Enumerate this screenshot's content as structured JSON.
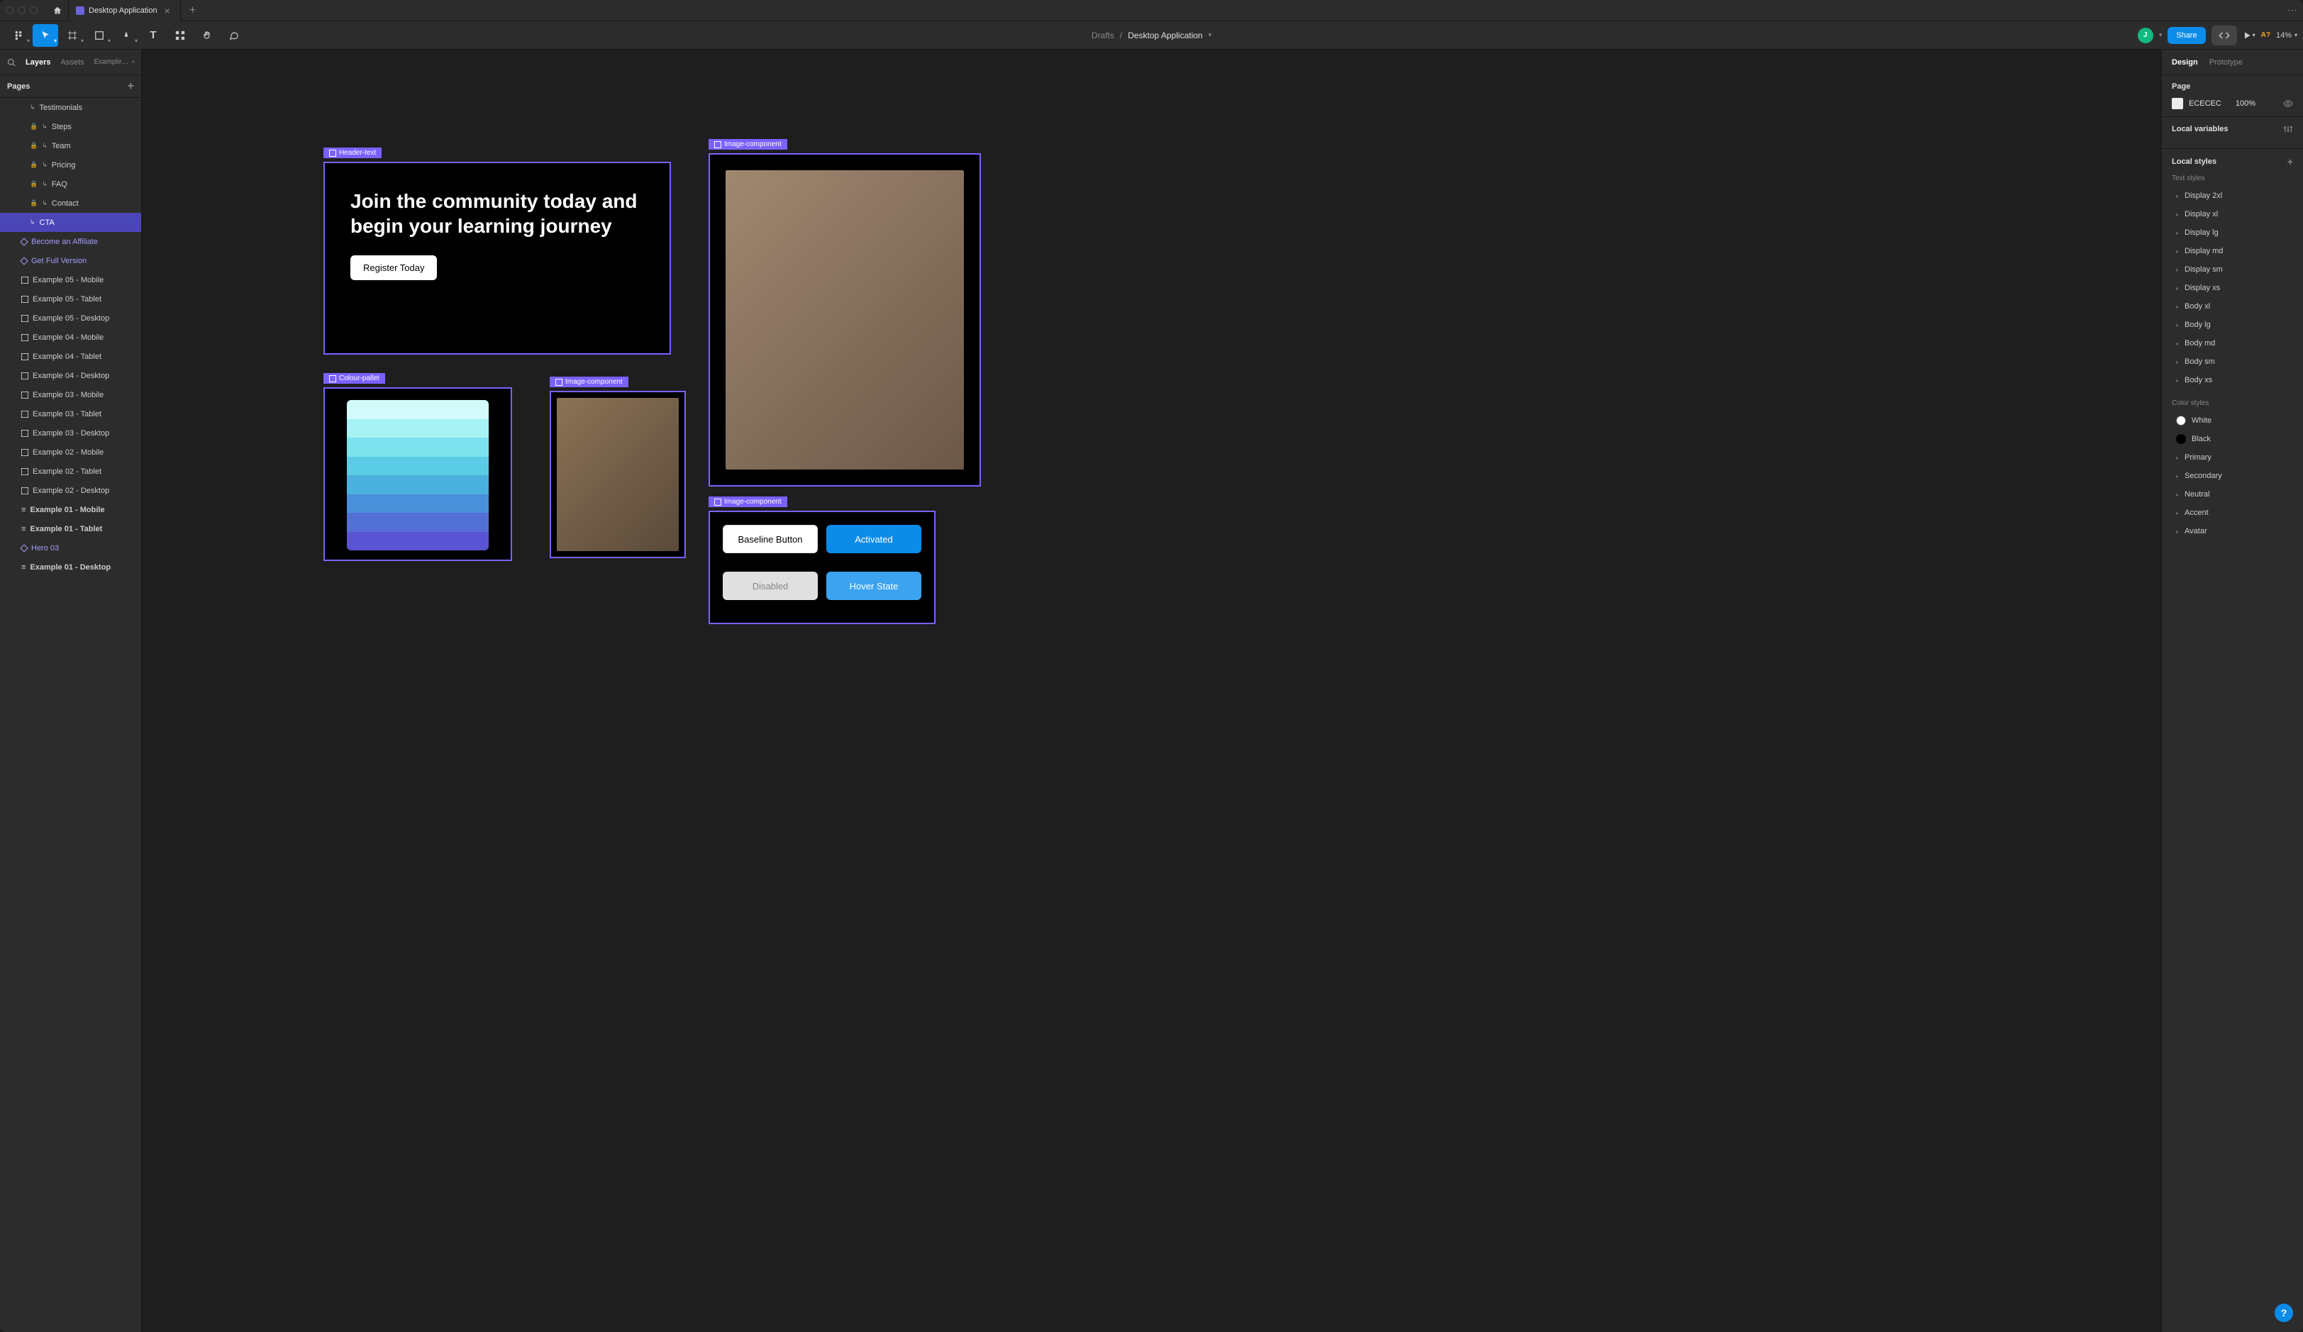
{
  "tab": {
    "title": "Desktop Application"
  },
  "breadcrumb": {
    "drafts": "Drafts",
    "file": "Desktop Application"
  },
  "toolbar": {
    "avatar": "J",
    "share": "Share",
    "ai": "A?",
    "zoom": "14%"
  },
  "leftPanel": {
    "tabs": {
      "layers": "Layers",
      "assets": "Assets",
      "dropdown": "Example…"
    },
    "pages": "Pages",
    "layers": [
      {
        "label": "Testimonials",
        "indent": true,
        "arrow": true
      },
      {
        "label": "Steps",
        "indent": true,
        "lock": true,
        "arrow": true
      },
      {
        "label": "Team",
        "indent": true,
        "lock": true,
        "arrow": true
      },
      {
        "label": "Pricing",
        "indent": true,
        "lock": true,
        "arrow": true
      },
      {
        "label": "FAQ",
        "indent": true,
        "lock": true,
        "arrow": true
      },
      {
        "label": "Contact",
        "indent": true,
        "lock": true,
        "arrow": true
      },
      {
        "label": "CTA",
        "indent": true,
        "arrow": true,
        "selected": true
      },
      {
        "label": "Become an Affiliate",
        "purple": true,
        "comp": true
      },
      {
        "label": "Get Full Version",
        "purple": true,
        "comp": true
      },
      {
        "label": "Example 05 - Mobile",
        "frame": true
      },
      {
        "label": "Example 05 - Tablet",
        "frame": true
      },
      {
        "label": "Example 05 - Desktop",
        "frame": true
      },
      {
        "label": "Example 04 - Mobile",
        "frame": true
      },
      {
        "label": "Example 04 - Tablet",
        "frame": true
      },
      {
        "label": "Example 04 - Desktop",
        "frame": true
      },
      {
        "label": "Example 03 - Mobile",
        "frame": true
      },
      {
        "label": "Example 03 - Tablet",
        "frame": true
      },
      {
        "label": "Example 03 - Desktop",
        "frame": true
      },
      {
        "label": "Example 02 - Mobile",
        "frame": true
      },
      {
        "label": "Example 02 - Tablet",
        "frame": true
      },
      {
        "label": "Example 02 - Desktop",
        "frame": true
      },
      {
        "label": "Example 01 - Mobile",
        "bold": true,
        "hframe": true
      },
      {
        "label": "Example 01 - Tablet",
        "bold": true,
        "hframe": true
      },
      {
        "label": "Hero 03",
        "purple": true,
        "comp": true
      },
      {
        "label": "Example 01 - Desktop",
        "bold": true,
        "hframe": true
      }
    ]
  },
  "canvas": {
    "frames": {
      "headerText": {
        "label": "Header-text",
        "heading": "Join the community today and begin your learning journey",
        "cta": "Register Today"
      },
      "palette": {
        "label": "Colour-pallet",
        "colors": [
          "#d3fbfb",
          "#a6f2f5",
          "#7ce3ee",
          "#5bcce6",
          "#4ab0dd",
          "#4a8fd9",
          "#5270d6",
          "#5a54d4"
        ]
      },
      "img1": {
        "label": "Image-component"
      },
      "img2": {
        "label": "Image-component"
      },
      "buttons": {
        "label": "Image-component",
        "b1": "Baseline Button",
        "b2": "Activated",
        "b3": "Disabled",
        "b4": "Hover State"
      }
    }
  },
  "rightPanel": {
    "tabs": {
      "design": "Design",
      "prototype": "Prototype"
    },
    "page": {
      "title": "Page",
      "color": "ECECEC",
      "opacity": "100%"
    },
    "localVars": "Local variables",
    "localStyles": "Local styles",
    "textStylesLabel": "Text styles",
    "textStyles": [
      "Display 2xl",
      "Display xl",
      "Display lg",
      "Display md",
      "Display sm",
      "Display xs",
      "Body xl",
      "Body lg",
      "Body md",
      "Body sm",
      "Body xs"
    ],
    "colorStylesLabel": "Color styles",
    "colorStyles": [
      {
        "name": "White",
        "color": "#ffffff"
      },
      {
        "name": "Black",
        "color": "#000000"
      },
      {
        "name": "Primary",
        "group": true
      },
      {
        "name": "Secondary",
        "group": true
      },
      {
        "name": "Neutral",
        "group": true
      },
      {
        "name": "Accent",
        "group": true
      },
      {
        "name": "Avatar",
        "group": true
      }
    ]
  }
}
